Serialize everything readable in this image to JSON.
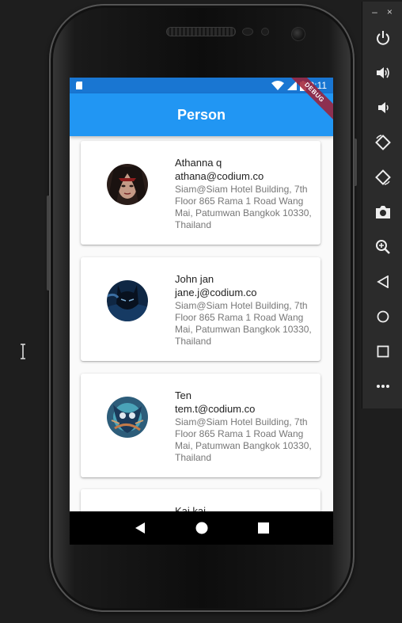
{
  "statusbar": {
    "time": "2:11",
    "debug_banner": "DEBUG"
  },
  "appbar": {
    "title": "Person"
  },
  "people": [
    {
      "name": "Athanna q",
      "email": "athana@codium.co",
      "address": "Siam@Siam Hotel Building, 7th Floor 865 Rama 1 Road Wang Mai, Patumwan Bangkok 10330, Thailand",
      "avatar_colors": [
        "#3a2a24",
        "#b88a78",
        "#7a1c1c"
      ]
    },
    {
      "name": "John jan",
      "email": "jane.j@codium.co",
      "address": "Siam@Siam Hotel Building, 7th Floor 865 Rama 1 Road Wang Mai, Patumwan Bangkok 10330, Thailand",
      "avatar_colors": [
        "#0d2340",
        "#3c6fa3",
        "#0a0f1c"
      ]
    },
    {
      "name": "Ten",
      "email": "tem.t@codium.co",
      "address": "Siam@Siam Hotel Building, 7th Floor 865 Rama 1 Road Wang Mai, Patumwan Bangkok 10330, Thailand",
      "avatar_colors": [
        "#4aa3b8",
        "#1b3a5a",
        "#c27a4a"
      ]
    },
    {
      "name": "Kai kai",
      "email": "",
      "address": "",
      "avatar_colors": [
        "#eeeeee",
        "#dddddd",
        "#cccccc"
      ]
    }
  ],
  "navbar": {
    "back_icon": "back-triangle-icon",
    "home_icon": "home-circle-icon",
    "recents_icon": "recents-square-icon"
  },
  "emulator_toolbar": {
    "minimize_label": "–",
    "close_label": "×",
    "buttons": [
      "power-icon",
      "volume-up-icon",
      "volume-down-icon",
      "rotate-left-icon",
      "rotate-right-icon",
      "camera-icon",
      "zoom-icon",
      "back-icon",
      "home-icon",
      "overview-icon",
      "more-icon"
    ]
  },
  "colors": {
    "appbar": "#2196f3",
    "statusbar": "#1976d2",
    "card": "#ffffff",
    "background": "#fafafa"
  }
}
